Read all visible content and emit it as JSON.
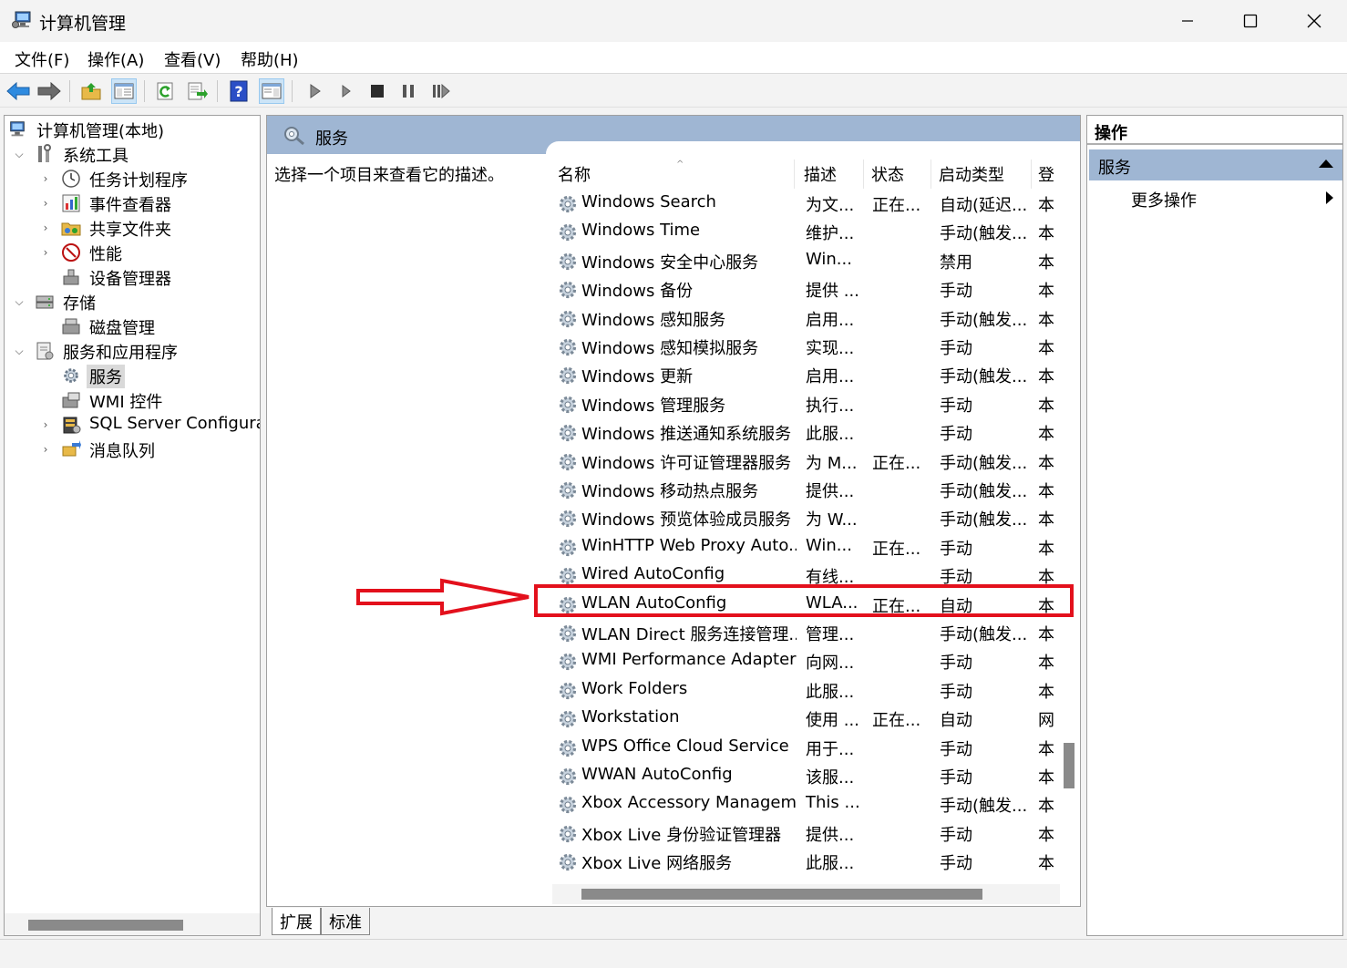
{
  "window": {
    "title": "计算机管理"
  },
  "menubar": {
    "items": [
      "文件(F)",
      "操作(A)",
      "查看(V)",
      "帮助(H)"
    ]
  },
  "tree": {
    "root": "计算机管理(本地)",
    "system_tools": "系统工具",
    "task_scheduler": "任务计划程序",
    "event_viewer": "事件查看器",
    "shared_folders": "共享文件夹",
    "performance": "性能",
    "device_manager": "设备管理器",
    "storage": "存储",
    "disk_management": "磁盘管理",
    "services_apps": "服务和应用程序",
    "services": "服务",
    "wmi_control": "WMI 控件",
    "sql_server": "SQL Server Configurati",
    "message_queue": "消息队列"
  },
  "center": {
    "header_title": "服务",
    "description_prompt": "选择一个项目来查看它的描述。",
    "columns": {
      "name": "名称",
      "desc": "描述",
      "status": "状态",
      "startup": "启动类型",
      "logon": "登"
    },
    "rows": [
      {
        "name": "Windows Search",
        "desc": "为文...",
        "status": "正在...",
        "startup": "自动(延迟...",
        "logon": "本"
      },
      {
        "name": "Windows Time",
        "desc": "维护...",
        "status": "",
        "startup": "手动(触发...",
        "logon": "本"
      },
      {
        "name": "Windows 安全中心服务",
        "desc": "Win...",
        "status": "",
        "startup": "禁用",
        "logon": "本"
      },
      {
        "name": "Windows 备份",
        "desc": "提供 ...",
        "status": "",
        "startup": "手动",
        "logon": "本"
      },
      {
        "name": "Windows 感知服务",
        "desc": "启用...",
        "status": "",
        "startup": "手动(触发...",
        "logon": "本"
      },
      {
        "name": "Windows 感知模拟服务",
        "desc": "实现...",
        "status": "",
        "startup": "手动",
        "logon": "本"
      },
      {
        "name": "Windows 更新",
        "desc": "启用...",
        "status": "",
        "startup": "手动(触发...",
        "logon": "本"
      },
      {
        "name": "Windows 管理服务",
        "desc": "执行...",
        "status": "",
        "startup": "手动",
        "logon": "本"
      },
      {
        "name": "Windows 推送通知系统服务",
        "desc": "此服...",
        "status": "",
        "startup": "手动",
        "logon": "本"
      },
      {
        "name": "Windows 许可证管理器服务",
        "desc": "为 M...",
        "status": "正在...",
        "startup": "手动(触发...",
        "logon": "本"
      },
      {
        "name": "Windows 移动热点服务",
        "desc": "提供...",
        "status": "",
        "startup": "手动(触发...",
        "logon": "本"
      },
      {
        "name": "Windows 预览体验成员服务",
        "desc": "为 W...",
        "status": "",
        "startup": "手动(触发...",
        "logon": "本"
      },
      {
        "name": "WinHTTP Web Proxy Auto...",
        "desc": "Win...",
        "status": "正在...",
        "startup": "手动",
        "logon": "本"
      },
      {
        "name": "Wired AutoConfig",
        "desc": "有线...",
        "status": "",
        "startup": "手动",
        "logon": "本"
      },
      {
        "name": "WLAN AutoConfig",
        "desc": "WLA...",
        "status": "正在...",
        "startup": "自动",
        "logon": "本"
      },
      {
        "name": "WLAN Direct 服务连接管理...",
        "desc": "管理...",
        "status": "",
        "startup": "手动(触发...",
        "logon": "本"
      },
      {
        "name": "WMI Performance Adapter",
        "desc": "向网...",
        "status": "",
        "startup": "手动",
        "logon": "本"
      },
      {
        "name": "Work Folders",
        "desc": "此服...",
        "status": "",
        "startup": "手动",
        "logon": "本"
      },
      {
        "name": "Workstation",
        "desc": "使用 ...",
        "status": "正在...",
        "startup": "自动",
        "logon": "网"
      },
      {
        "name": "WPS Office Cloud Service",
        "desc": "用于...",
        "status": "",
        "startup": "手动",
        "logon": "本"
      },
      {
        "name": "WWAN AutoConfig",
        "desc": "该服...",
        "status": "",
        "startup": "手动",
        "logon": "本"
      },
      {
        "name": "Xbox Accessory Managem...",
        "desc": "This ...",
        "status": "",
        "startup": "手动(触发...",
        "logon": "本"
      },
      {
        "name": "Xbox Live 身份验证管理器",
        "desc": "提供...",
        "status": "",
        "startup": "手动",
        "logon": "本"
      },
      {
        "name": "Xbox Live 网络服务",
        "desc": "此服...",
        "status": "",
        "startup": "手动",
        "logon": "本"
      }
    ]
  },
  "tabs": {
    "extended": "扩展",
    "standard": "标准"
  },
  "actions": {
    "title": "操作",
    "section": "服务",
    "more": "更多操作"
  },
  "colors": {
    "header_blue": "#9fb6d3",
    "highlight_red": "#e3101c"
  }
}
